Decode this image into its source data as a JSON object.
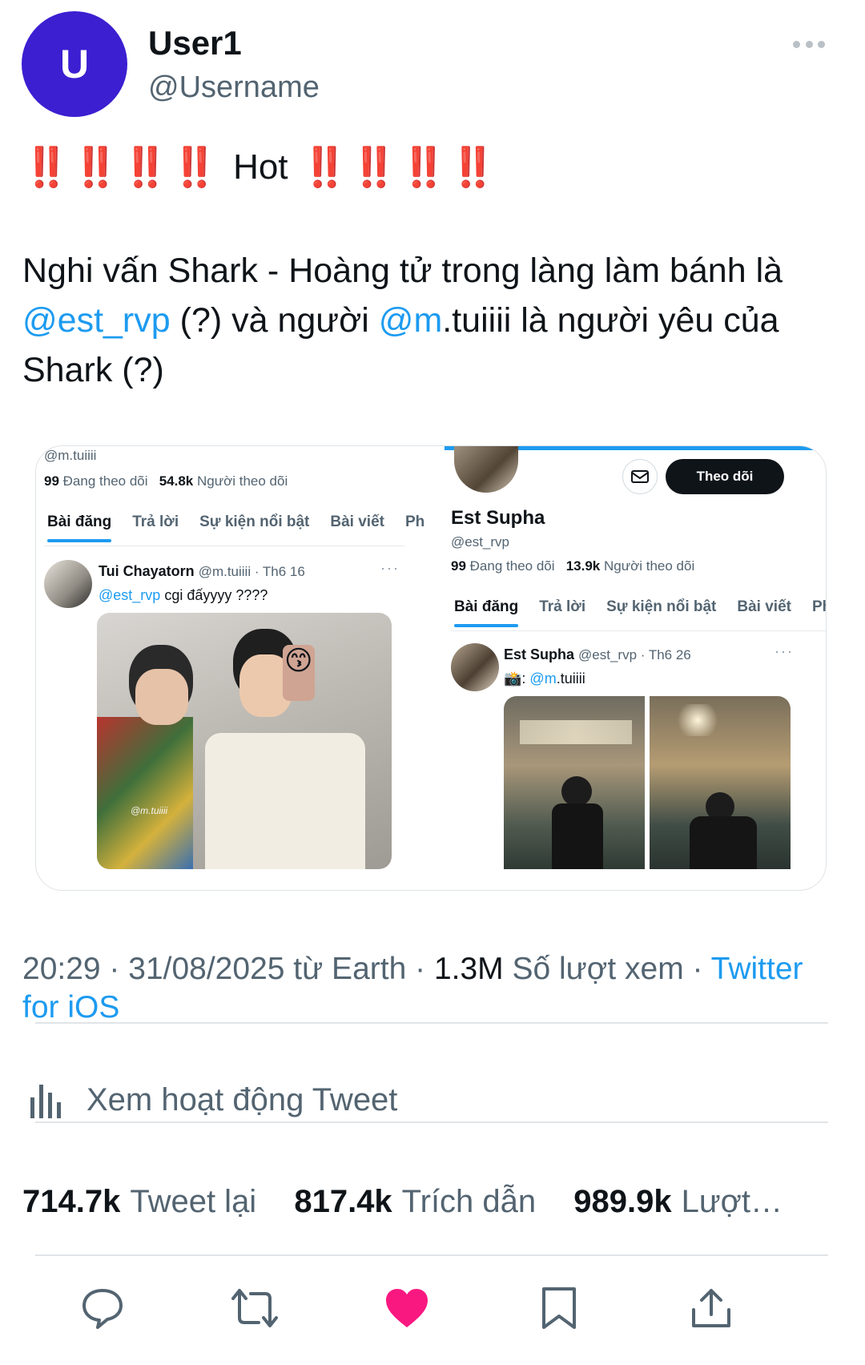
{
  "author": {
    "avatar_letter": "U",
    "display_name": "User1",
    "handle": "@Username",
    "avatar_color": "#3b1fd1"
  },
  "tweet": {
    "bangs_left": "‼️‼️‼️‼️",
    "bangs_right": "‼️‼️‼️‼️",
    "hot": "Hot",
    "text_1": "Nghi vấn Shark - Hoàng tử trong làng làm bánh là ",
    "mention_1": "@est_rvp",
    "text_2": " (?) và người ",
    "mention_2": "@m",
    "text_3": ".tuiiii là người yêu của Shark (?)"
  },
  "embed": {
    "left": {
      "top_handle": "@m.tuiiii",
      "following_count": "99",
      "following_label": "Đang theo dõi",
      "followers_count": "54.8k",
      "followers_label": "Người theo dõi",
      "tabs": [
        "Bài đăng",
        "Trả lời",
        "Sự kiện nổi bật",
        "Bài viết",
        "Ph"
      ],
      "post_name": "Tui Chayatorn",
      "post_meta": "@m.tuiiii · Th6 16",
      "post_mention": "@est_rvp",
      "post_text": " cgi đấyyyy ????",
      "emoji": "😙",
      "watermark": "@m.tuiiii"
    },
    "right": {
      "follow_button": "Theo dõi",
      "name": "Est Supha",
      "handle": "@est_rvp",
      "following_count": "99",
      "following_label": "Đang theo dõi",
      "followers_count": "13.9k",
      "followers_label": "Người theo dõi",
      "tabs": [
        "Bài đăng",
        "Trả lời",
        "Sự kiện nổi bật",
        "Bài viết",
        "Ph"
      ],
      "post_name": "Est Supha",
      "post_meta": "@est_rvp · Th6 26",
      "post_prefix": "📸: ",
      "post_mention": "@m",
      "post_suffix": ".tuiiii"
    }
  },
  "meta": {
    "time": "20:29 · 31/08/2025 từ Earth · ",
    "views_count": "1.3M",
    "views_label": " Số lượt xem · ",
    "source": "Twitter for iOS"
  },
  "activity_label": "Xem hoạt động Tweet",
  "stats": {
    "retweets_count": "714.7k",
    "retweets_label": "Tweet lại",
    "quotes_count": "817.4k",
    "quotes_label": "Trích dẫn",
    "likes_count": "989.9k",
    "likes_label": "Lượt…"
  },
  "colors": {
    "accent": "#1d9bf0",
    "like": "#f91880",
    "bang": "#e8141b"
  }
}
